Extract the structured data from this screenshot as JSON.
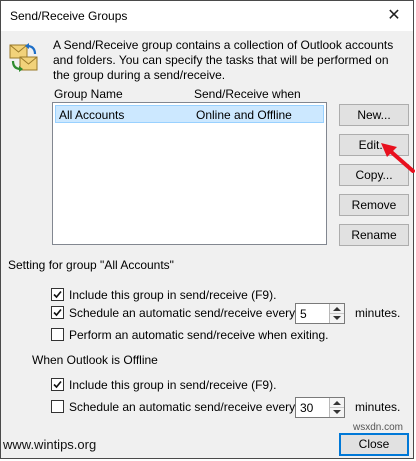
{
  "window": {
    "title": "Send/Receive Groups",
    "close_glyph": "✕"
  },
  "description": "A Send/Receive group contains a collection of Outlook accounts and folders. You can specify the tasks that will be performed on the group during a send/receive.",
  "groups_list": {
    "columns": [
      "Group Name",
      "Send/Receive when"
    ],
    "rows": [
      {
        "name": "All Accounts",
        "when": "Online and Offline",
        "selected": true
      }
    ]
  },
  "buttons": {
    "new": "New...",
    "edit": "Edit...",
    "copy": "Copy...",
    "remove": "Remove",
    "rename": "Rename",
    "close": "Close"
  },
  "online_settings": {
    "label": "Setting for group \"All Accounts\"",
    "include": {
      "label": "Include this group in send/receive (F9).",
      "checked": true
    },
    "schedule": {
      "label": "Schedule an automatic send/receive every",
      "checked": true,
      "value": "5",
      "unit": "minutes."
    },
    "on_exit": {
      "label": "Perform an automatic send/receive when exiting.",
      "checked": false
    }
  },
  "offline_settings": {
    "label": "When Outlook is Offline",
    "include": {
      "label": "Include this group in send/receive (F9).",
      "checked": true
    },
    "schedule": {
      "label": "Schedule an automatic send/receive every",
      "checked": false,
      "value": "30",
      "unit": "minutes."
    }
  },
  "watermarks": {
    "main": "www.wintips.org",
    "corner": "wsxdn.com"
  },
  "colors": {
    "selection": "#cce8ff",
    "focus_border": "#0078d7",
    "arrow": "#e8101e"
  },
  "icons": {
    "dialog": "send-receive-sync-icon",
    "pointer": "red-arrow-icon"
  }
}
